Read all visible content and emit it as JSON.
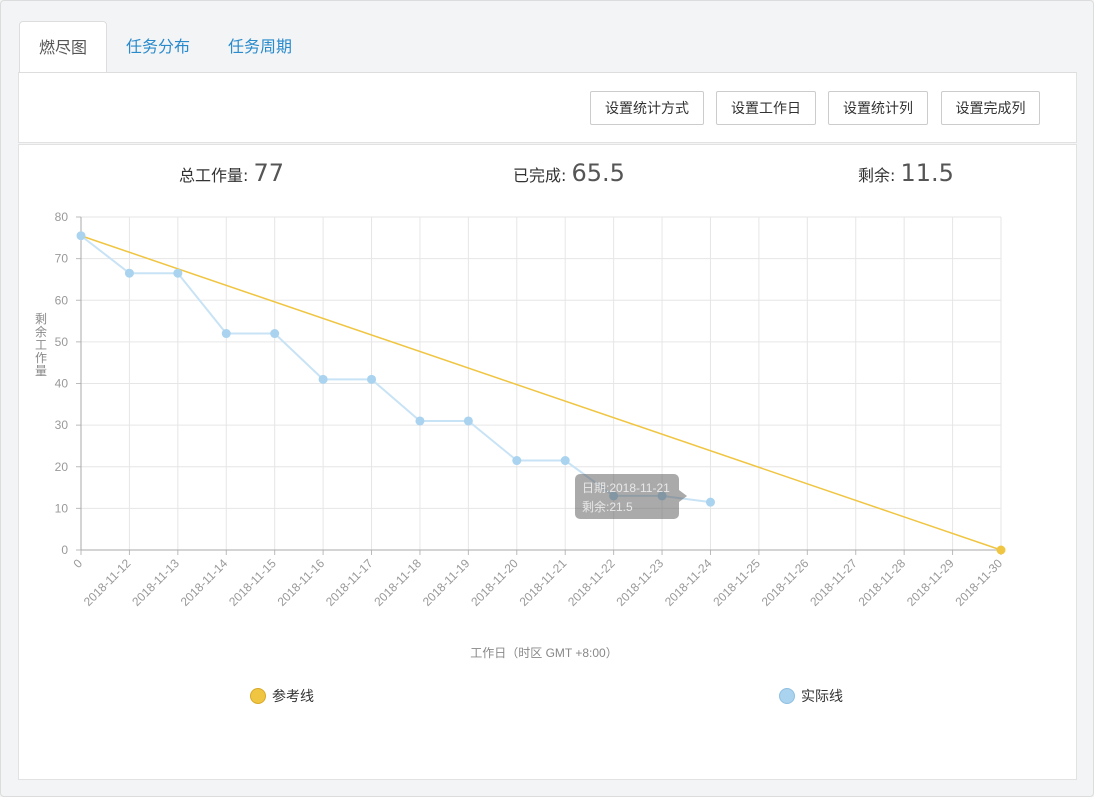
{
  "tabs": [
    {
      "label": "燃尽图",
      "active": true
    },
    {
      "label": "任务分布",
      "active": false
    },
    {
      "label": "任务周期",
      "active": false
    }
  ],
  "toolbar": {
    "buttons": [
      "设置统计方式",
      "设置工作日",
      "设置统计列",
      "设置完成列"
    ]
  },
  "stats": {
    "total_label": "总工作量:",
    "total_value": "77",
    "done_label": "已完成:",
    "done_value": "65.5",
    "remaining_label": "剩余:",
    "remaining_value": "11.5"
  },
  "tooltip": {
    "date_line": "日期:2018-11-21",
    "remain_line": "剩余:21.5"
  },
  "colors": {
    "reference": "#f0c541",
    "actual": "#a9d3ef",
    "tab_link": "#2a8bcc"
  },
  "chart_data": {
    "type": "line",
    "x": [
      "0",
      "2018-11-12",
      "2018-11-13",
      "2018-11-14",
      "2018-11-15",
      "2018-11-16",
      "2018-11-17",
      "2018-11-18",
      "2018-11-19",
      "2018-11-20",
      "2018-11-21",
      "2018-11-22",
      "2018-11-23",
      "2018-11-24",
      "2018-11-25",
      "2018-11-26",
      "2018-11-27",
      "2018-11-28",
      "2018-11-29",
      "2018-11-30"
    ],
    "series": [
      {
        "name": "参考线",
        "values": [
          75.5,
          null,
          null,
          null,
          null,
          null,
          null,
          null,
          null,
          null,
          null,
          null,
          null,
          null,
          null,
          null,
          null,
          null,
          null,
          0
        ]
      },
      {
        "name": "实际线",
        "values": [
          75.5,
          66.5,
          66.5,
          52,
          52,
          41,
          41,
          31,
          31,
          21.5,
          21.5,
          13,
          13,
          11.5,
          null,
          null,
          null,
          null,
          null,
          null
        ]
      }
    ],
    "ylim": [
      0,
      80
    ],
    "yticks": [
      0,
      10,
      20,
      30,
      40,
      50,
      60,
      70,
      80
    ],
    "xlabel": "工作日（时区 GMT +8:00）",
    "ylabel": "剩余工作量",
    "grid": true,
    "legend": "bottom"
  }
}
